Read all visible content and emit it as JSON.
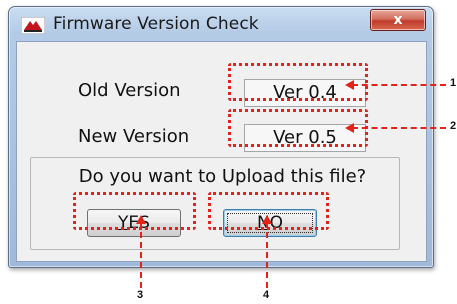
{
  "window": {
    "title": "Firmware Version Check",
    "close_label": "x"
  },
  "fields": {
    "old_version_label": "Old Version",
    "old_version_value": "Ver 0.4",
    "new_version_label": "New Version",
    "new_version_value": "Ver 0.5"
  },
  "prompt": {
    "question": "Do you want to Upload this file?"
  },
  "buttons": {
    "yes_accel": "Y",
    "yes_rest": "ES",
    "no_accel": "N",
    "no_rest": "O"
  },
  "annotations": {
    "callout_1": "1",
    "callout_2": "2",
    "callout_3": "3",
    "callout_4": "4",
    "color": "#e2231a"
  },
  "colors": {
    "close_button": "#c0392b",
    "titlebar": "#b4cbe6",
    "client": "#f0f0f0"
  },
  "icons": {
    "app": "app-logo-icon",
    "close": "close-icon"
  }
}
